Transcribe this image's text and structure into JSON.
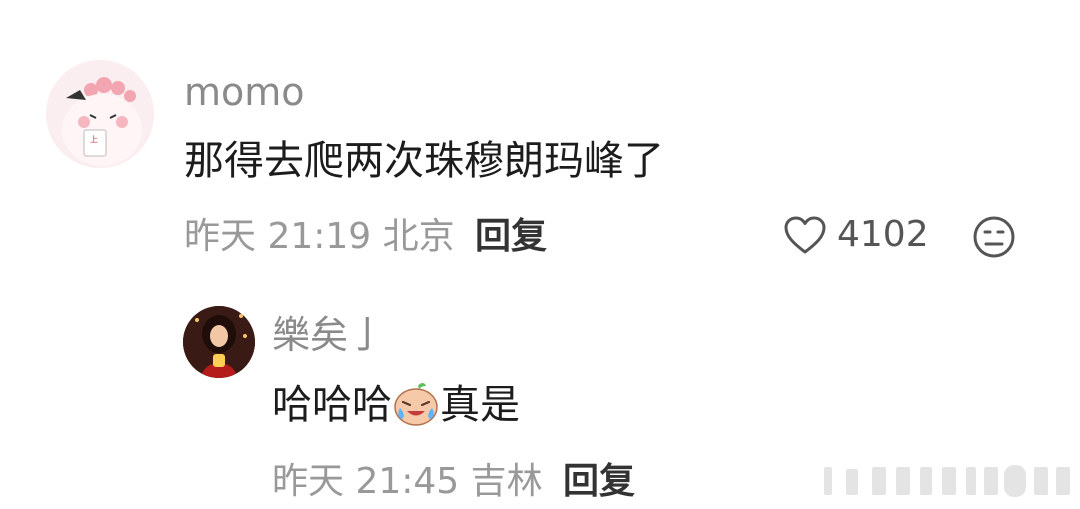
{
  "comments": [
    {
      "username": "momo",
      "text": "那得去爬两次珠穆朗玛峰了",
      "time": "昨天 21:19",
      "location": "北京",
      "reply_label": "回复",
      "like_count": "4102"
    },
    {
      "username": "樂矣亅",
      "text_before": "哈哈哈",
      "text_after": "真是",
      "emoji": "crying-laughing-emoji",
      "time": "昨天 21:45",
      "location": "吉林",
      "reply_label": "回复"
    }
  ],
  "icons": {
    "like": "heart-outline-icon",
    "dislike": "neutral-face-icon"
  }
}
